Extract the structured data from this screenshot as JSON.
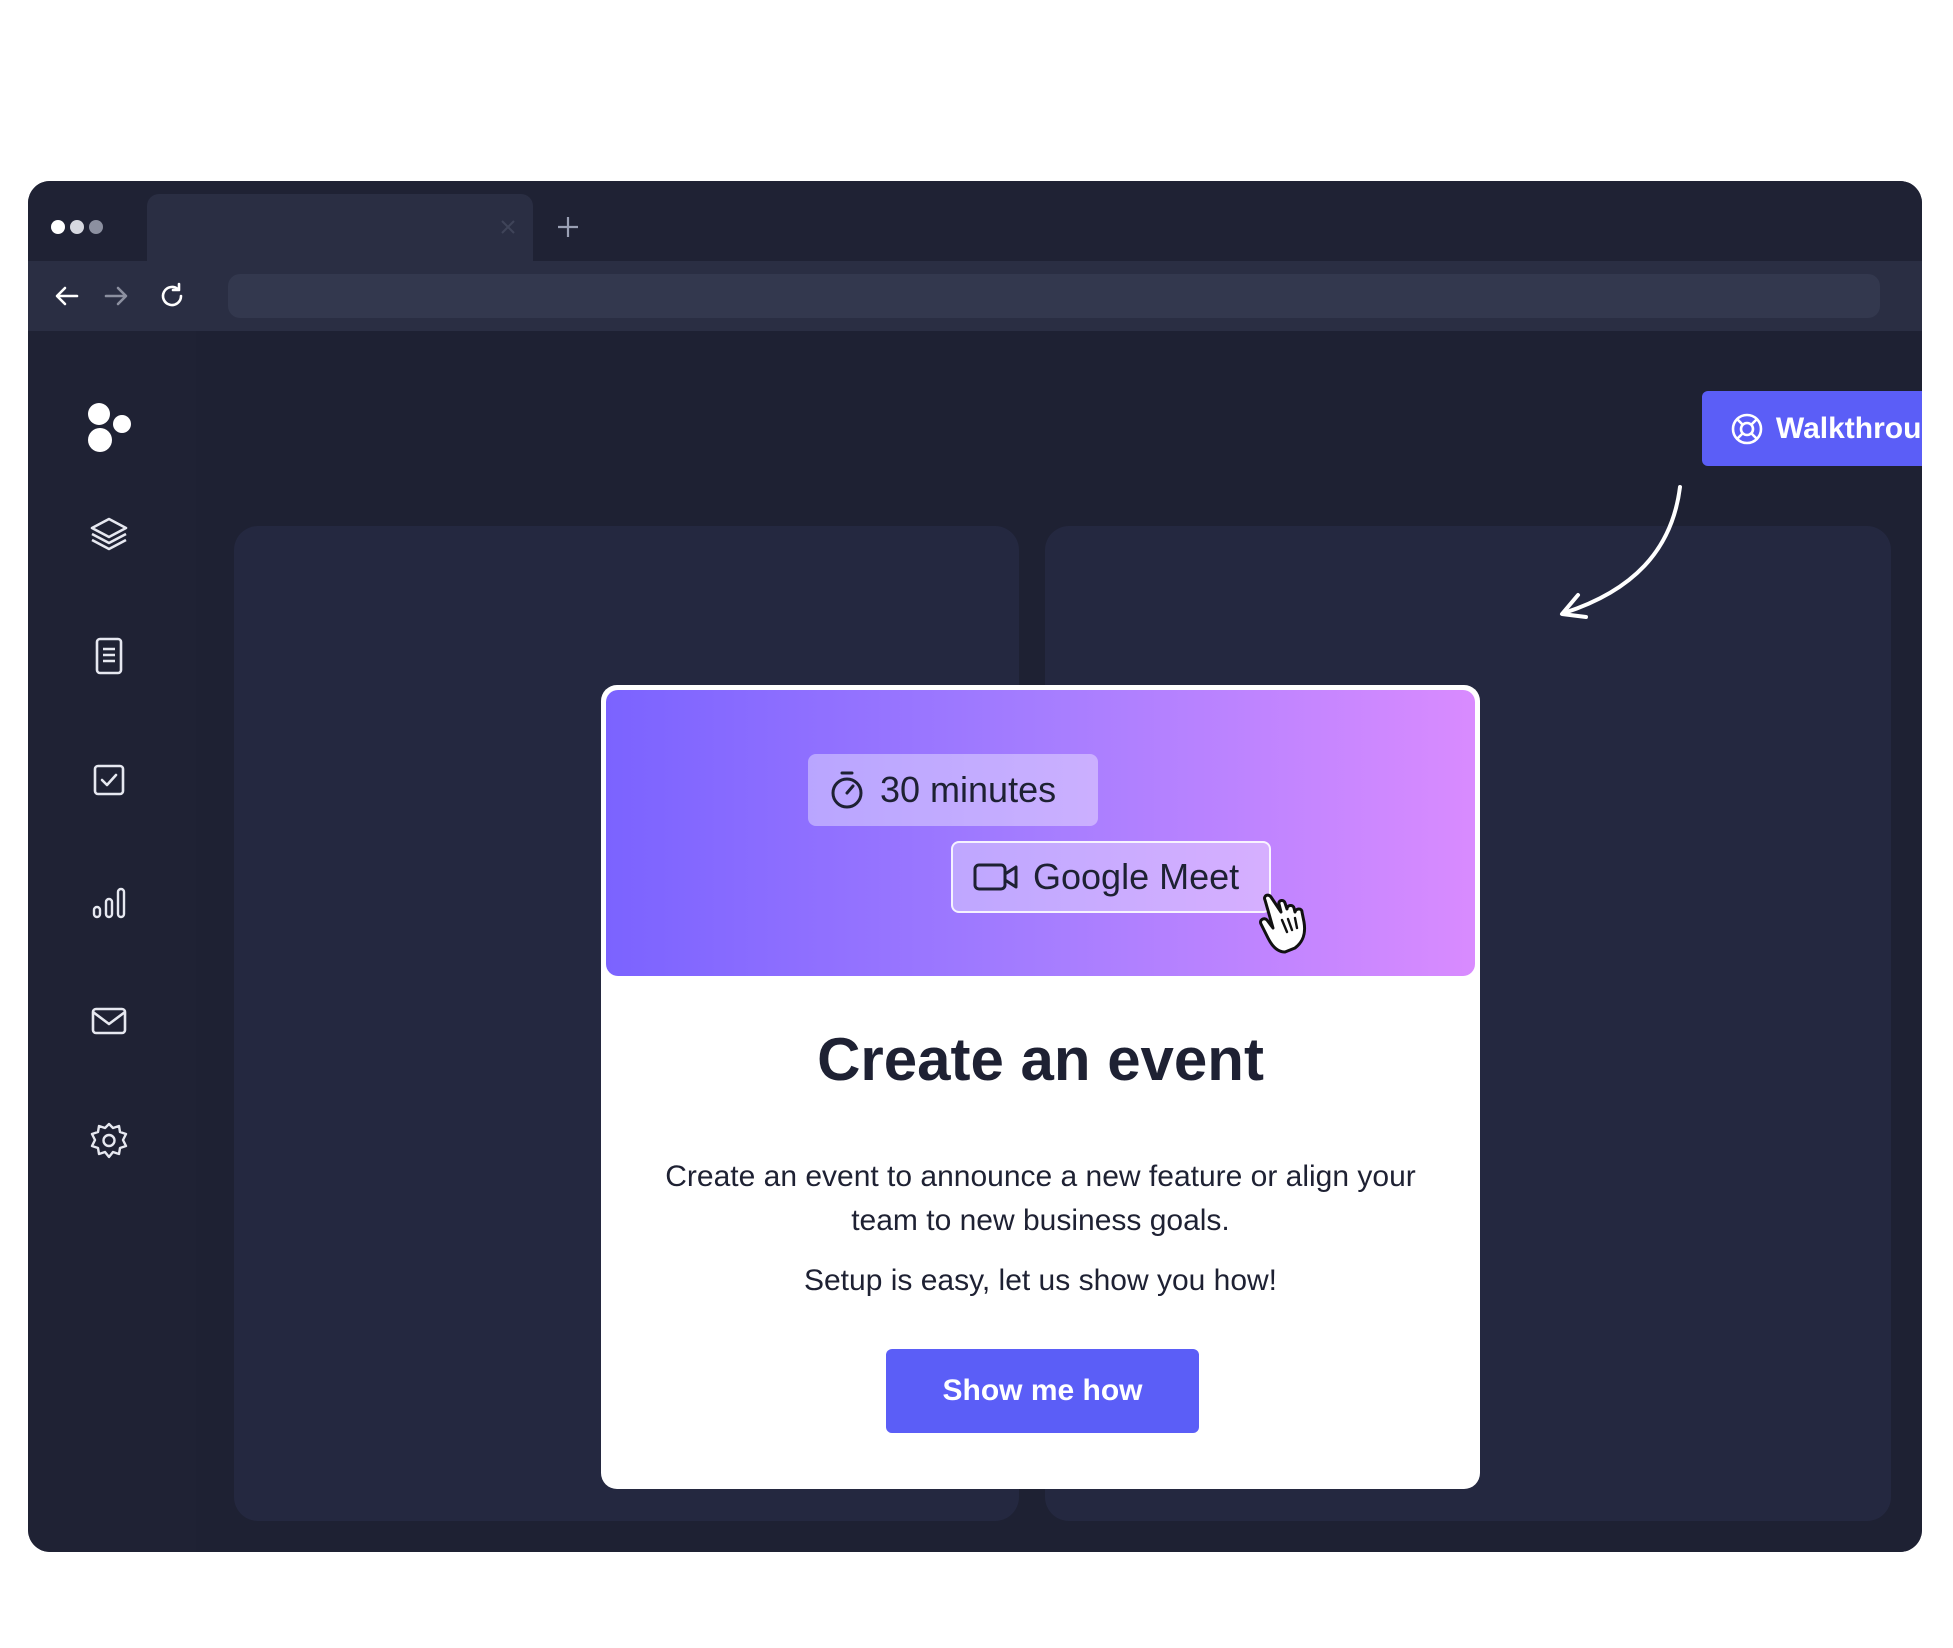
{
  "browser": {
    "window_controls": [
      "dot",
      "dot",
      "dot"
    ],
    "tab": {
      "close_icon": "close-icon"
    },
    "new_tab_icon": "plus-icon",
    "nav": {
      "back_icon": "arrow-left-icon",
      "forward_icon": "arrow-right-icon",
      "reload_icon": "reload-icon"
    },
    "url": ""
  },
  "sidebar": {
    "logo_icon": "dots-logo-icon",
    "items": [
      {
        "icon": "layers-icon"
      },
      {
        "icon": "document-icon"
      },
      {
        "icon": "checkbox-icon"
      },
      {
        "icon": "bar-chart-icon"
      },
      {
        "icon": "mail-icon"
      },
      {
        "icon": "gear-icon"
      }
    ]
  },
  "walkthrough": {
    "label": "Walkthrough",
    "icon": "lifebuoy-icon"
  },
  "modal": {
    "chips": {
      "duration": "30 minutes",
      "duration_icon": "stopwatch-icon",
      "location": "Google Meet",
      "location_icon": "video-camera-icon"
    },
    "title": "Create an event",
    "body": "Create an event to announce a new feature or align your team to new business goals.",
    "note": "Setup is easy, let us show you how!",
    "cta_label": "Show me how"
  },
  "colors": {
    "accent": "#5b5ef7",
    "frame_bg": "#1f2234",
    "panel_bg": "#242840",
    "hero_gradient_start": "#7b63ff",
    "hero_gradient_end": "#d98bff"
  }
}
